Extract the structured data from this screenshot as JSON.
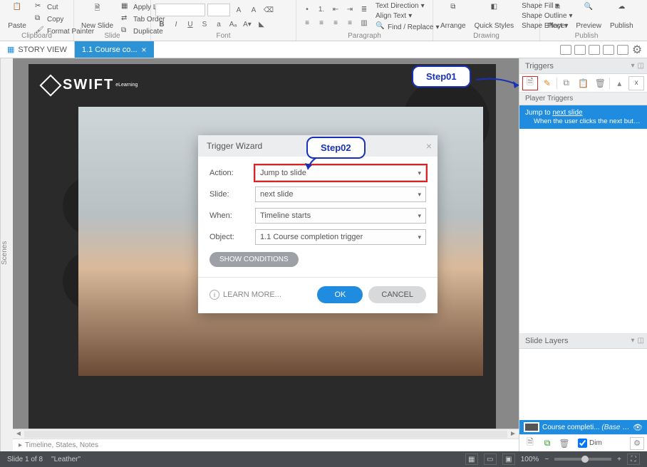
{
  "ribbon": {
    "clipboard": {
      "label": "Clipboard",
      "paste": "Paste",
      "cut": "Cut",
      "copy": "Copy",
      "format_painter": "Format Painter"
    },
    "slide": {
      "label": "Slide",
      "new_slide": "New Slide",
      "apply_layout": "Apply Layout",
      "tab_order": "Tab Order",
      "duplicate": "Duplicate"
    },
    "font": {
      "label": "Font"
    },
    "paragraph": {
      "label": "Paragraph",
      "text_direction": "Text Direction",
      "align_text": "Align Text",
      "find_replace": "Find / Replace"
    },
    "drawing": {
      "label": "Drawing",
      "arrange": "Arrange",
      "quick_styles": "Quick Styles",
      "shape_fill": "Shape Fill",
      "shape_outline": "Shape Outline",
      "shape_effect": "Shape Effect"
    },
    "publish": {
      "label": "Publish",
      "player": "Player",
      "preview": "Preview",
      "publish_btn": "Publish"
    }
  },
  "tabs": {
    "story_view": "STORY VIEW",
    "active_tab": "1.1 Course co..."
  },
  "scenes_label": "Scenes",
  "logo": {
    "brand": "SWIFT",
    "sub": "eLearning"
  },
  "steps": {
    "step1": "Step01",
    "step2": "Step02"
  },
  "wizard": {
    "title": "Trigger Wizard",
    "labels": {
      "action": "Action:",
      "slide": "Slide:",
      "when": "When:",
      "object": "Object:"
    },
    "values": {
      "action": "Jump to slide",
      "slide": "next slide",
      "when": "Timeline starts",
      "object": "1.1 Course completion trigger"
    },
    "show_conditions": "SHOW CONDITIONS",
    "learn_more": "LEARN MORE...",
    "ok": "OK",
    "cancel": "CANCEL"
  },
  "triggers_panel": {
    "title": "Triggers",
    "player_triggers": "Player Triggers",
    "item": {
      "action": "Jump to",
      "target": "next slide",
      "detail": "When the user clicks the next button or s..."
    },
    "slide_layers": "Slide Layers",
    "layer_name": "Course completi...",
    "layer_type": "(Base Layer)",
    "dim": "Dim"
  },
  "timeline_bar": "Timeline, States, Notes",
  "status": {
    "slide": "Slide 1 of 8",
    "name": "\"Leather\"",
    "zoom_label": "100%"
  }
}
